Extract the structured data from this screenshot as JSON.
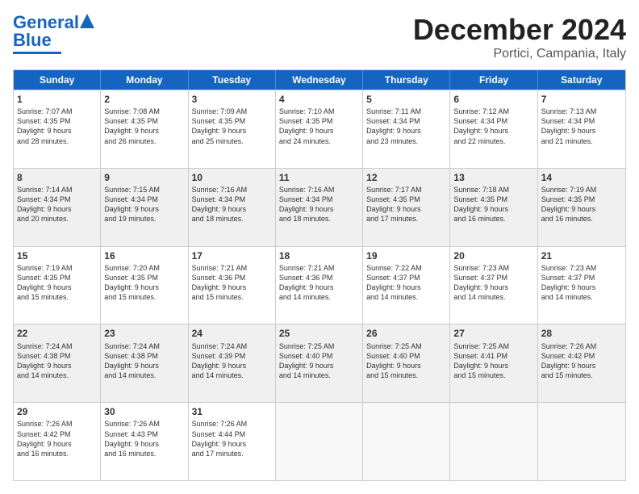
{
  "logo": {
    "line1": "General",
    "line2": "Blue"
  },
  "title": "December 2024",
  "subtitle": "Portici, Campania, Italy",
  "days": [
    "Sunday",
    "Monday",
    "Tuesday",
    "Wednesday",
    "Thursday",
    "Friday",
    "Saturday"
  ],
  "weeks": [
    [
      {
        "day": "1",
        "lines": [
          "Sunrise: 7:07 AM",
          "Sunset: 4:35 PM",
          "Daylight: 9 hours",
          "and 28 minutes."
        ]
      },
      {
        "day": "2",
        "lines": [
          "Sunrise: 7:08 AM",
          "Sunset: 4:35 PM",
          "Daylight: 9 hours",
          "and 26 minutes."
        ]
      },
      {
        "day": "3",
        "lines": [
          "Sunrise: 7:09 AM",
          "Sunset: 4:35 PM",
          "Daylight: 9 hours",
          "and 25 minutes."
        ]
      },
      {
        "day": "4",
        "lines": [
          "Sunrise: 7:10 AM",
          "Sunset: 4:35 PM",
          "Daylight: 9 hours",
          "and 24 minutes."
        ]
      },
      {
        "day": "5",
        "lines": [
          "Sunrise: 7:11 AM",
          "Sunset: 4:34 PM",
          "Daylight: 9 hours",
          "and 23 minutes."
        ]
      },
      {
        "day": "6",
        "lines": [
          "Sunrise: 7:12 AM",
          "Sunset: 4:34 PM",
          "Daylight: 9 hours",
          "and 22 minutes."
        ]
      },
      {
        "day": "7",
        "lines": [
          "Sunrise: 7:13 AM",
          "Sunset: 4:34 PM",
          "Daylight: 9 hours",
          "and 21 minutes."
        ]
      }
    ],
    [
      {
        "day": "8",
        "lines": [
          "Sunrise: 7:14 AM",
          "Sunset: 4:34 PM",
          "Daylight: 9 hours",
          "and 20 minutes."
        ]
      },
      {
        "day": "9",
        "lines": [
          "Sunrise: 7:15 AM",
          "Sunset: 4:34 PM",
          "Daylight: 9 hours",
          "and 19 minutes."
        ]
      },
      {
        "day": "10",
        "lines": [
          "Sunrise: 7:16 AM",
          "Sunset: 4:34 PM",
          "Daylight: 9 hours",
          "and 18 minutes."
        ]
      },
      {
        "day": "11",
        "lines": [
          "Sunrise: 7:16 AM",
          "Sunset: 4:34 PM",
          "Daylight: 9 hours",
          "and 18 minutes."
        ]
      },
      {
        "day": "12",
        "lines": [
          "Sunrise: 7:17 AM",
          "Sunset: 4:35 PM",
          "Daylight: 9 hours",
          "and 17 minutes."
        ]
      },
      {
        "day": "13",
        "lines": [
          "Sunrise: 7:18 AM",
          "Sunset: 4:35 PM",
          "Daylight: 9 hours",
          "and 16 minutes."
        ]
      },
      {
        "day": "14",
        "lines": [
          "Sunrise: 7:19 AM",
          "Sunset: 4:35 PM",
          "Daylight: 9 hours",
          "and 16 minutes."
        ]
      }
    ],
    [
      {
        "day": "15",
        "lines": [
          "Sunrise: 7:19 AM",
          "Sunset: 4:35 PM",
          "Daylight: 9 hours",
          "and 15 minutes."
        ]
      },
      {
        "day": "16",
        "lines": [
          "Sunrise: 7:20 AM",
          "Sunset: 4:35 PM",
          "Daylight: 9 hours",
          "and 15 minutes."
        ]
      },
      {
        "day": "17",
        "lines": [
          "Sunrise: 7:21 AM",
          "Sunset: 4:36 PM",
          "Daylight: 9 hours",
          "and 15 minutes."
        ]
      },
      {
        "day": "18",
        "lines": [
          "Sunrise: 7:21 AM",
          "Sunset: 4:36 PM",
          "Daylight: 9 hours",
          "and 14 minutes."
        ]
      },
      {
        "day": "19",
        "lines": [
          "Sunrise: 7:22 AM",
          "Sunset: 4:37 PM",
          "Daylight: 9 hours",
          "and 14 minutes."
        ]
      },
      {
        "day": "20",
        "lines": [
          "Sunrise: 7:23 AM",
          "Sunset: 4:37 PM",
          "Daylight: 9 hours",
          "and 14 minutes."
        ]
      },
      {
        "day": "21",
        "lines": [
          "Sunrise: 7:23 AM",
          "Sunset: 4:37 PM",
          "Daylight: 9 hours",
          "and 14 minutes."
        ]
      }
    ],
    [
      {
        "day": "22",
        "lines": [
          "Sunrise: 7:24 AM",
          "Sunset: 4:38 PM",
          "Daylight: 9 hours",
          "and 14 minutes."
        ]
      },
      {
        "day": "23",
        "lines": [
          "Sunrise: 7:24 AM",
          "Sunset: 4:38 PM",
          "Daylight: 9 hours",
          "and 14 minutes."
        ]
      },
      {
        "day": "24",
        "lines": [
          "Sunrise: 7:24 AM",
          "Sunset: 4:39 PM",
          "Daylight: 9 hours",
          "and 14 minutes."
        ]
      },
      {
        "day": "25",
        "lines": [
          "Sunrise: 7:25 AM",
          "Sunset: 4:40 PM",
          "Daylight: 9 hours",
          "and 14 minutes."
        ]
      },
      {
        "day": "26",
        "lines": [
          "Sunrise: 7:25 AM",
          "Sunset: 4:40 PM",
          "Daylight: 9 hours",
          "and 15 minutes."
        ]
      },
      {
        "day": "27",
        "lines": [
          "Sunrise: 7:25 AM",
          "Sunset: 4:41 PM",
          "Daylight: 9 hours",
          "and 15 minutes."
        ]
      },
      {
        "day": "28",
        "lines": [
          "Sunrise: 7:26 AM",
          "Sunset: 4:42 PM",
          "Daylight: 9 hours",
          "and 15 minutes."
        ]
      }
    ],
    [
      {
        "day": "29",
        "lines": [
          "Sunrise: 7:26 AM",
          "Sunset: 4:42 PM",
          "Daylight: 9 hours",
          "and 16 minutes."
        ]
      },
      {
        "day": "30",
        "lines": [
          "Sunrise: 7:26 AM",
          "Sunset: 4:43 PM",
          "Daylight: 9 hours",
          "and 16 minutes."
        ]
      },
      {
        "day": "31",
        "lines": [
          "Sunrise: 7:26 AM",
          "Sunset: 4:44 PM",
          "Daylight: 9 hours",
          "and 17 minutes."
        ]
      },
      {
        "day": "",
        "lines": []
      },
      {
        "day": "",
        "lines": []
      },
      {
        "day": "",
        "lines": []
      },
      {
        "day": "",
        "lines": []
      }
    ]
  ]
}
